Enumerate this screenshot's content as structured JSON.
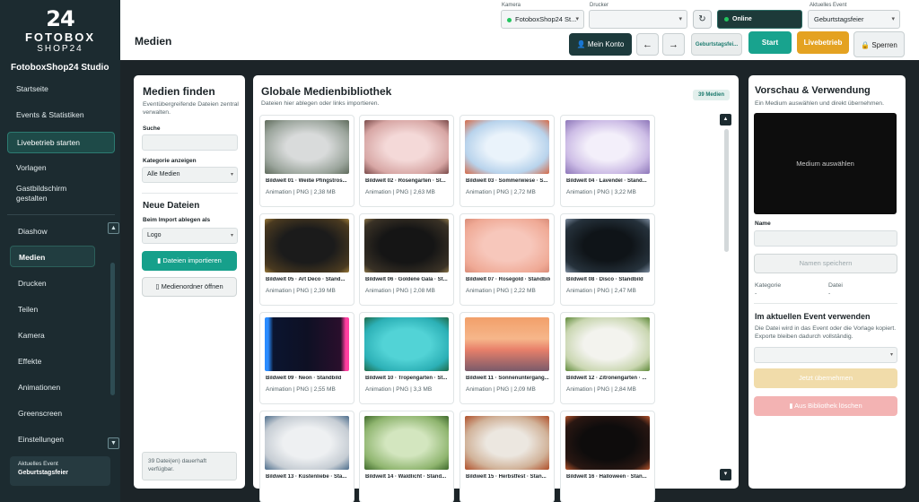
{
  "app": {
    "logo_number": "24",
    "logo_line1": "FOTOBOX",
    "logo_line2": "SHOP24",
    "studio_name": "FotoboxShop24 Studio"
  },
  "sidebar": {
    "top_items": [
      {
        "label": "Startseite"
      },
      {
        "label": "Events & Statistiken"
      },
      {
        "label": "Livebetrieb starten"
      },
      {
        "label": "Vorlagen"
      },
      {
        "label": "Gastbildschirm gestalten"
      }
    ],
    "bottom_items": [
      {
        "label": "Diashow"
      },
      {
        "label": "Medien"
      },
      {
        "label": "Drucken"
      },
      {
        "label": "Teilen"
      },
      {
        "label": "Kamera"
      },
      {
        "label": "Effekte"
      },
      {
        "label": "Animationen"
      },
      {
        "label": "Greenscreen"
      },
      {
        "label": "Einstellungen"
      }
    ],
    "current_event_label": "Aktuelles Event",
    "current_event_value": "Geburtstagsfeier"
  },
  "header": {
    "title": "Medien",
    "kamera_label": "Kamera",
    "kamera_value": "FotoboxShop24 St...",
    "drucker_label": "Drucker",
    "drucker_value": "",
    "online_label": "Online",
    "event_label": "Aktuelles Event",
    "event_value": "Geburtstagsfeier",
    "konto_label": "Mein Konto",
    "geb_label": "Geburtstagsfei...",
    "start_label": "Start",
    "live_label": "Livebetrieb",
    "lock_label": "Sperren"
  },
  "finder": {
    "title": "Medien finden",
    "subtitle": "Eventübergreifende Dateien zentral verwalten.",
    "search_label": "Suche",
    "search_value": "",
    "category_label": "Kategorie anzeigen",
    "category_value": "Alle Medien",
    "new_files_title": "Neue Dateien",
    "import_label": "Beim Import ablegen als",
    "import_value": "Logo",
    "import_button": "Dateien importieren",
    "folder_button": "Medienordner öffnen",
    "footer_hint": "39 Datei(en) dauerhaft verfügbar."
  },
  "library": {
    "title": "Globale Medienbibliothek",
    "subtitle": "Dateien hier ablegen oder links importieren.",
    "count_badge": "39 Medien",
    "items": [
      {
        "name": "Bildwelt 01 · Weiße Pfingstros...",
        "meta": "Animation | PNG | 2,38 MB"
      },
      {
        "name": "Bildwelt 02 · Rosengarten · St...",
        "meta": "Animation | PNG | 2,63 MB"
      },
      {
        "name": "Bildwelt 03 · Sommerwiese · S...",
        "meta": "Animation | PNG | 2,72 MB"
      },
      {
        "name": "Bildwelt 04 · Lavendel · Stand...",
        "meta": "Animation | PNG | 3,22 MB"
      },
      {
        "name": "Bildwelt 05 · Art Deco · Stand...",
        "meta": "Animation | PNG | 2,39 MB"
      },
      {
        "name": "Bildwelt 06 · Goldene Gala · St...",
        "meta": "Animation | PNG | 2,08 MB"
      },
      {
        "name": "Bildwelt 07 · Roségold · Standbild",
        "meta": "Animation | PNG | 2,22 MB"
      },
      {
        "name": "Bildwelt 08 · Disco · Standbild",
        "meta": "Animation | PNG | 2,47 MB"
      },
      {
        "name": "Bildwelt 09 · Neon · Standbild",
        "meta": "Animation | PNG | 2,55 MB"
      },
      {
        "name": "Bildwelt 10 · Tropengarten · St...",
        "meta": "Animation | PNG | 3,3 MB"
      },
      {
        "name": "Bildwelt 11 · Sonnenuntergang...",
        "meta": "Animation | PNG | 2,09 MB"
      },
      {
        "name": "Bildwelt 12 · Zitronengarten · ...",
        "meta": "Animation | PNG | 2,84 MB"
      },
      {
        "name": "Bildwelt 13 · Küstenliebe · Sta...",
        "meta": ""
      },
      {
        "name": "Bildwelt 14 · Waldlicht · Stand...",
        "meta": ""
      },
      {
        "name": "Bildwelt 15 · Herbstfest · Stan...",
        "meta": ""
      },
      {
        "name": "Bildwelt 16 · Halloween · Stan...",
        "meta": ""
      }
    ]
  },
  "preview": {
    "title": "Vorschau & Verwendung",
    "subtitle": "Ein Medium auswählen und direkt übernehmen.",
    "placeholder": "Medium auswählen",
    "name_label": "Name",
    "name_value": "",
    "save_name_button": "Namen speichern",
    "kategorie_label": "Kategorie",
    "kategorie_value": "-",
    "datei_label": "Datei",
    "datei_value": "-",
    "use_title": "Im aktuellen Event verwenden",
    "use_subtitle": "Die Datei wird in das Event oder die Vorlage kopiert. Exporte bleiben dadurch vollständig.",
    "use_select_value": "",
    "apply_button": "Jetzt übernehmen",
    "delete_button": "Aus Bibliothek löschen"
  },
  "colors": {
    "accent": "#16a08b",
    "sidebar_bg": "#1c2b30",
    "live_button": "#e4a221",
    "danger_button": "#f3b3b3",
    "disabled_apply": "#f1dcaa"
  }
}
